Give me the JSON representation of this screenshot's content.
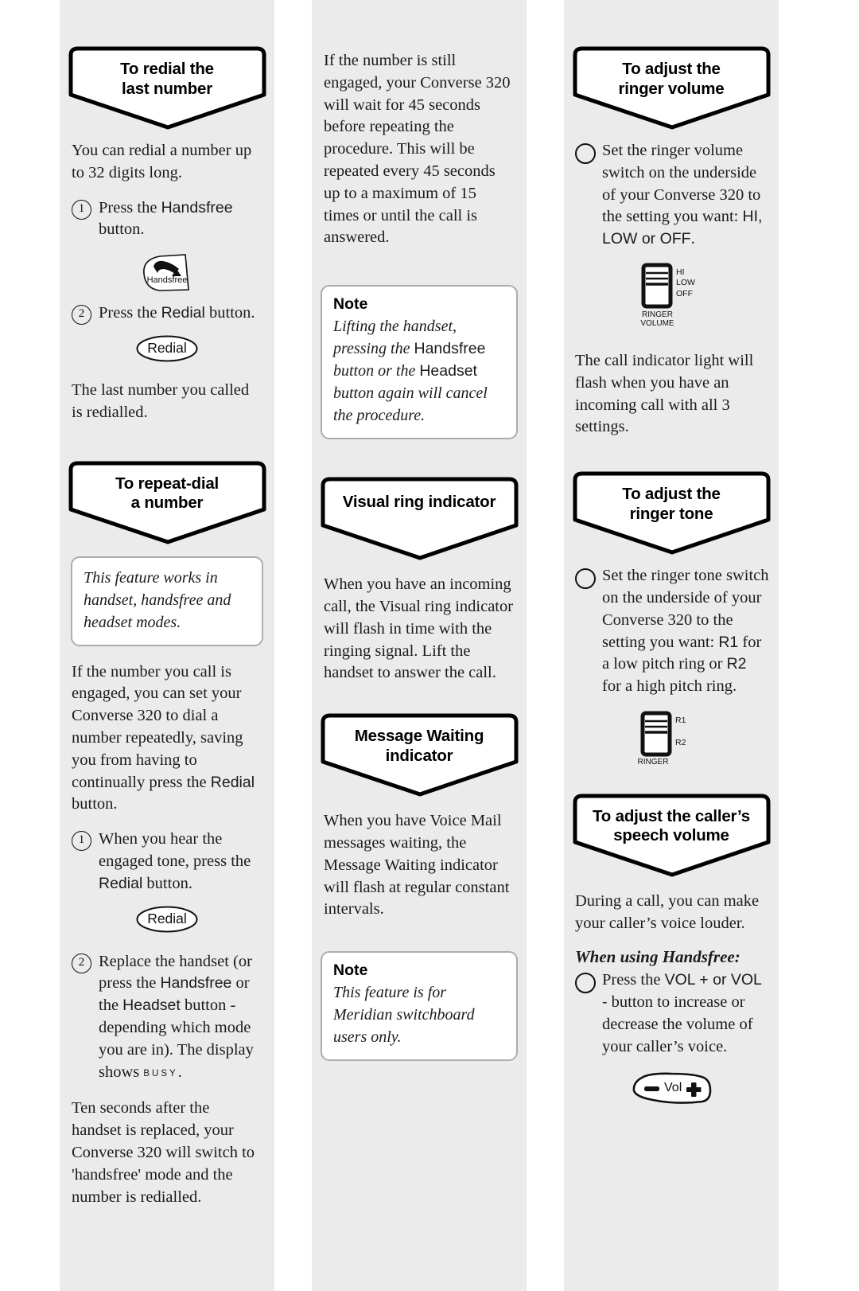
{
  "document": {
    "type": "telephone-user-guide-page",
    "product": "Converse 320",
    "background_color": "#ffffff",
    "column_color": "#ebebeb"
  },
  "columns": [
    {
      "id": "left",
      "blocks": [
        {
          "kind": "banner",
          "lines": [
            "To redial the",
            "last number"
          ]
        },
        {
          "kind": "para",
          "text": "You can redial a number up to 32 digits long."
        },
        {
          "kind": "step",
          "marker": "1",
          "text_before": "Press the ",
          "sans": "Handsfree",
          "text_after": " button."
        },
        {
          "kind": "icon",
          "name": "handsfree-button-icon",
          "label": "Handsfree"
        },
        {
          "kind": "step",
          "marker": "2",
          "text_before": "Press the ",
          "sans": "Redial",
          "text_after": " button."
        },
        {
          "kind": "icon",
          "name": "redial-button-icon",
          "label": "Redial"
        },
        {
          "kind": "para",
          "text": "The last number you called is redialled."
        },
        {
          "kind": "banner",
          "lines": [
            "To repeat-dial",
            "a number"
          ]
        },
        {
          "kind": "note",
          "heading": "",
          "text": "This feature works in handset, handsfree and headset modes."
        },
        {
          "kind": "para",
          "text": "If the number you call is engaged, you can set your Converse 320 to dial a number repeatedly, saving you from having to continually press the Redial button."
        },
        {
          "kind": "step",
          "marker": "1",
          "text": "When you hear the engaged tone, press the Redial button."
        },
        {
          "kind": "icon",
          "name": "redial-button-icon",
          "label": "Redial"
        },
        {
          "kind": "step",
          "marker": "2",
          "text": "Replace the handset (or press the Handsfree or the Headset button - depending which mode you are in). The display shows BUSY ."
        },
        {
          "kind": "para",
          "text": "Ten seconds after the handset is replaced, your Converse 320 will switch to 'handsfree' mode and the number is redialled."
        }
      ]
    },
    {
      "id": "middle",
      "blocks": [
        {
          "kind": "para",
          "text": "If the number is still engaged, your Converse 320 will wait for 45 seconds before repeating the procedure. This will be repeated every 45 seconds up to a maximum of 15 times or until the call is answered."
        },
        {
          "kind": "note",
          "heading": "Note",
          "text": "Lifting the handset, pressing the Handsfree button or the Headset button again will cancel the procedure."
        },
        {
          "kind": "banner",
          "lines": [
            "Visual ring indicator"
          ]
        },
        {
          "kind": "para",
          "text": "When you have an incoming call, the Visual ring indicator will flash in time with the ringing signal. Lift the handset to answer the call."
        },
        {
          "kind": "banner",
          "lines": [
            "Message Waiting",
            "indicator"
          ]
        },
        {
          "kind": "para",
          "text": "When you have Voice Mail messages waiting, the Message Waiting indicator will flash at regular constant intervals."
        },
        {
          "kind": "note",
          "heading": "Note",
          "text": "This feature is for Meridian switchboard users only."
        }
      ]
    },
    {
      "id": "right",
      "blocks": [
        {
          "kind": "banner",
          "lines": [
            "To adjust the",
            "ringer volume"
          ]
        },
        {
          "kind": "step",
          "marker": "circle",
          "text": "Set the ringer volume switch on the underside of your Converse 320 to the setting you want: HI, LOW or OFF."
        },
        {
          "kind": "icon",
          "name": "ringer-volume-switch-icon",
          "settings": [
            "HI",
            "LOW",
            "OFF"
          ],
          "caption": [
            "RINGER",
            "VOLUME"
          ]
        },
        {
          "kind": "para",
          "text": "The call indicator light will flash when you have an incoming call with all 3 settings."
        },
        {
          "kind": "banner",
          "lines": [
            "To adjust the",
            "ringer tone"
          ]
        },
        {
          "kind": "step",
          "marker": "circle",
          "text": "Set the ringer tone switch on the underside of your Converse 320 to the setting you want: R1 for a low pitch ring or R2 for a high pitch ring."
        },
        {
          "kind": "icon",
          "name": "ringer-tone-switch-icon",
          "settings": [
            "R1",
            "R2"
          ],
          "caption": [
            "RINGER"
          ]
        },
        {
          "kind": "banner",
          "lines": [
            "To adjust the caller's",
            "speech volume"
          ]
        },
        {
          "kind": "para",
          "text": "During a call, you can make your caller's voice louder."
        },
        {
          "kind": "heading_italic",
          "text": "When using Handsfree:"
        },
        {
          "kind": "step",
          "marker": "circle",
          "text": "Press the VOL + or VOL - button to increase or decrease the volume of your caller's voice."
        },
        {
          "kind": "icon",
          "name": "volume-rocker-button-icon",
          "label": "Vol",
          "minus": "−",
          "plus": "+"
        }
      ]
    }
  ],
  "left": {
    "banner1_line1": "To redial the",
    "banner1_line2": "last number",
    "p1": "You can redial a number up to 32 digits long.",
    "step1_num": "1",
    "step1_a": "Press the ",
    "step1_sans": "Handsfree",
    "step1_b": " button.",
    "handsfree_label": "Handsfree",
    "step2_num": "2",
    "step2_a": "Press the ",
    "step2_sans": "Redial",
    "step2_b": " button.",
    "redial_label": "Redial",
    "p2": "The last number you called is redialled.",
    "banner2_line1": "To repeat-dial",
    "banner2_line2": "a number",
    "note1": "This feature works in handset, handsfree and headset modes.",
    "p3_a": "If the number you call is engaged, you can set your Converse 320 to dial a number repeatedly, saving you from having to continually press the ",
    "p3_sans": "Redial",
    "p3_b": " button.",
    "step3_num": "1",
    "step3_a": "When you hear the engaged tone, press the ",
    "step3_sans": "Redial",
    "step3_b": " button.",
    "redial_label2": "Redial",
    "step4_num": "2",
    "step4_a": "Replace the handset (or press the ",
    "step4_sans1": "Handsfree",
    "step4_b": " or the ",
    "step4_sans2": "Headset",
    "step4_c": " button - depending which mode you are in). The display shows ",
    "step4_lcd": "BUSY",
    "step4_d": ".",
    "p4": "Ten seconds after the handset is replaced, your Converse 320 will switch to 'handsfree' mode and the number is redialled."
  },
  "middle": {
    "p1": "If the number is still engaged, your Converse 320 will wait for 45 seconds before repeating the procedure. This will be repeated every 45 seconds up to a maximum of 15 times or until the call is answered.",
    "note1_heading": "Note",
    "note1_a": "Lifting the handset, pressing the ",
    "note1_sans1": "Handsfree",
    "note1_b": " button or the ",
    "note1_sans2": "Headset",
    "note1_c": " button again will cancel the procedure.",
    "banner1": "Visual ring indicator",
    "p2": "When you have an incoming call, the Visual ring indicator will flash in time with the ringing signal. Lift the handset to answer the call.",
    "banner2_line1": "Message Waiting",
    "banner2_line2": "indicator",
    "p3": "When you have Voice Mail messages waiting, the Message Waiting indicator will flash at regular constant intervals.",
    "note2_heading": "Note",
    "note2": "This feature is for Meridian switchboard users only."
  },
  "right": {
    "banner1_line1": "To adjust the",
    "banner1_line2": "ringer volume",
    "step1_a": "Set the ringer volume switch on the underside of your Converse 320 to the setting you want: ",
    "step1_sans": "HI, LOW or OFF",
    "step1_b": ".",
    "sw1_hi": "HI",
    "sw1_low": "LOW",
    "sw1_off": "OFF",
    "sw1_cap1": "RINGER",
    "sw1_cap2": "VOLUME",
    "p1": "The call indicator light will flash when you have an incoming call with all 3 settings.",
    "banner2_line1": "To adjust the",
    "banner2_line2": "ringer tone",
    "step2_a": "Set the ringer tone switch on the underside of your Converse 320 to the setting you want: ",
    "step2_sans1": "R1",
    "step2_b": " for a low pitch ring or ",
    "step2_sans2": "R2",
    "step2_c": " for a high pitch ring.",
    "sw2_r1": "R1",
    "sw2_r2": "R2",
    "sw2_cap": "RINGER",
    "banner3_line1": "To adjust the caller’s",
    "banner3_line2": "speech volume",
    "p2": "During a call, you can make your caller’s voice louder.",
    "h_italic": "When using Handsfree:",
    "step3_a": "Press the ",
    "step3_sans": "VOL + or VOL -",
    "step3_b": " button to increase or decrease the volume of your caller’s voice.",
    "vol_label": "Vol"
  }
}
